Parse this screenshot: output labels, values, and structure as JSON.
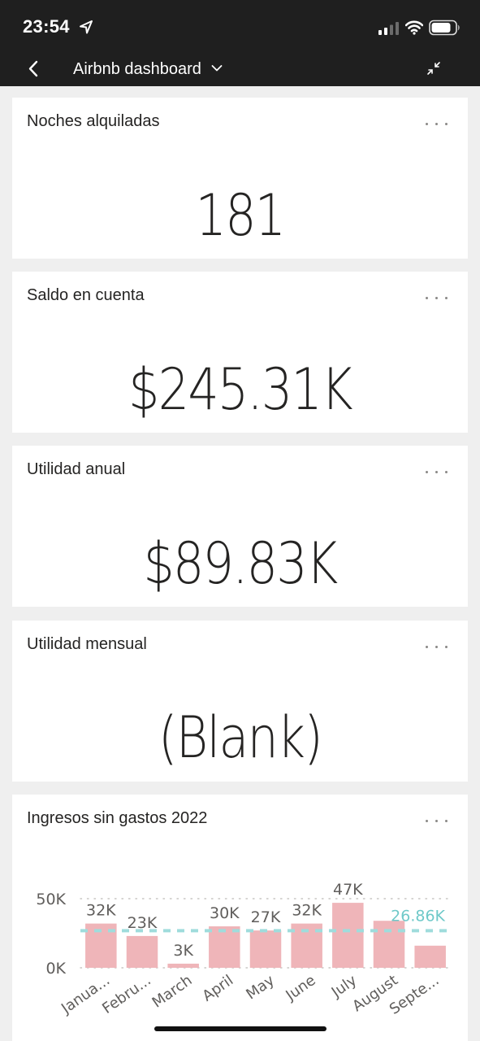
{
  "status_bar": {
    "time": "23:54"
  },
  "nav": {
    "title": "Airbnb dashboard"
  },
  "tiles": [
    {
      "title": "Noches alquiladas",
      "value": "181"
    },
    {
      "title": "Saldo en cuenta",
      "value": "$245.31K"
    },
    {
      "title": "Utilidad anual",
      "value": "$89.83K"
    },
    {
      "title": "Utilidad mensual",
      "value": "(Blank)"
    }
  ],
  "chart_tile": {
    "title": "Ingresos sin gastos 2022"
  },
  "chart_data": {
    "type": "bar",
    "title": "Ingresos sin gastos 2022",
    "categories": [
      "Janua...",
      "Febru...",
      "March",
      "April",
      "May",
      "June",
      "July",
      "August",
      "Septe..."
    ],
    "values": [
      32000,
      23000,
      3000,
      30000,
      27000,
      32000,
      47000,
      34000,
      16000
    ],
    "data_labels": [
      "32K",
      "23K",
      "3K",
      "30K",
      "27K",
      "32K",
      "47K",
      "",
      ""
    ],
    "y_ticks": [
      "0K",
      "50K"
    ],
    "ylim": [
      0,
      50000
    ],
    "average_line": {
      "value": 26860,
      "label": "26.86K"
    },
    "grid": true,
    "colors": {
      "bar": "#efb5b9",
      "average_line": "#9fdcdc",
      "average_label": "#6fc9c9"
    }
  }
}
